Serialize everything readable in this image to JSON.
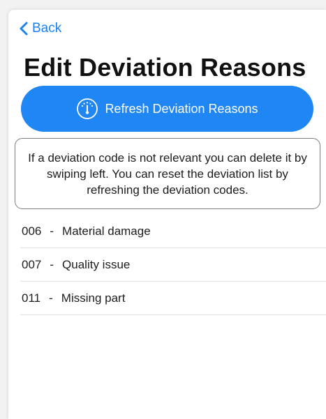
{
  "nav": {
    "back_label": "Back"
  },
  "header": {
    "title": "Edit Deviation Reasons"
  },
  "refresh": {
    "label": "Refresh Deviation Reasons"
  },
  "info": {
    "text": "If a deviation code is not relevant you can delete it by swiping left. You can reset the deviation list by refreshing the deviation codes."
  },
  "reasons": [
    {
      "code": "006",
      "separator": "-",
      "label": "Material damage"
    },
    {
      "code": "007",
      "separator": "-",
      "label": "Quality issue"
    },
    {
      "code": "011",
      "separator": "-",
      "label": "Missing part"
    }
  ],
  "colors": {
    "accent": "#1f86f3",
    "link": "#1a82f0"
  },
  "icons": {
    "back": "chevron-left-icon",
    "refresh": "gauge-icon"
  }
}
